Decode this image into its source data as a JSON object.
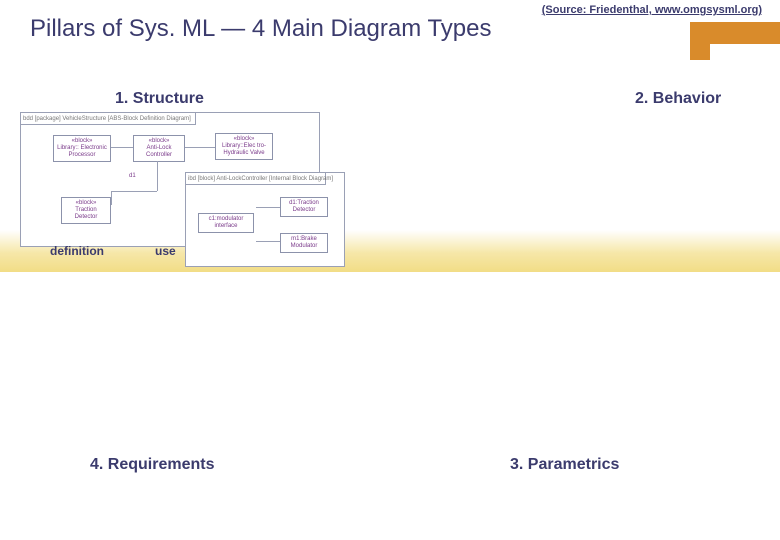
{
  "source_text": "(Source: Friedenthal, www.omgsysml.org)",
  "title": "Pillars of Sys. ML — 4 Main Diagram Types",
  "pillars": {
    "p1": "1. Structure",
    "p2": "2. Behavior",
    "p3": "3. Parametrics",
    "p4": "4. Requirements"
  },
  "sub_labels": {
    "definition": "definition",
    "use": "use"
  },
  "bdd": {
    "frame_label": "bdd [package] VehicleStructure [ABS-Block Definition Diagram]",
    "blocks": {
      "processor": {
        "stereo": "«block»",
        "name": "Library::\nElectronic\nProcessor"
      },
      "anti_lock": {
        "stereo": "«block»",
        "name": "Anti-Lock\nController"
      },
      "valve": {
        "stereo": "«block»",
        "name": "Library::Elec\ntro-Hydraulic\nValve"
      },
      "traction": {
        "stereo": "«block»",
        "name": "Traction\nDetector"
      }
    },
    "d1_label": "d1"
  },
  "ibd": {
    "frame_label": "ibd [block] Anti-LockController [Internal Block Diagram]",
    "parts": {
      "c1": "c1:modulator\ninterface",
      "d1": "d1:Traction\nDetector",
      "m1": "m1:Brake\nModulator"
    }
  }
}
